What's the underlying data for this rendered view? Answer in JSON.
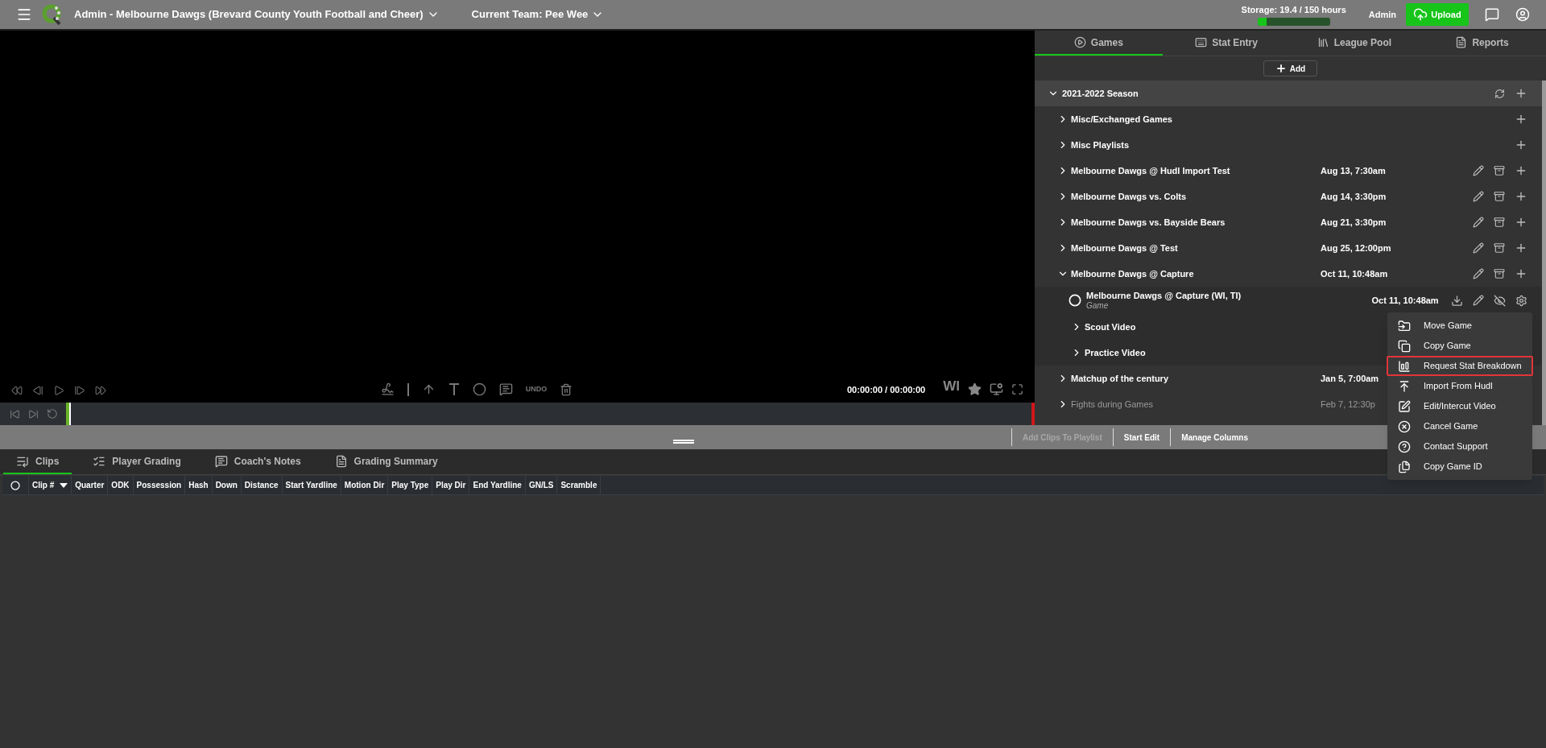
{
  "header": {
    "account": "Admin - Melbourne Dawgs (Brevard County Youth Football and Cheer)",
    "team": "Current Team: Pee Wee",
    "storage": {
      "label": "Storage: 19.4 / 150 hours",
      "level": 0.13
    },
    "user": "Admin",
    "upload": "Upload"
  },
  "player": {
    "undo": "UNDO",
    "time": "00:00:00 / 00:00:00",
    "badge": "WI"
  },
  "panel_tabs": [
    {
      "label": "Games",
      "selected": true
    },
    {
      "label": "Stat Entry",
      "selected": false
    },
    {
      "label": "League Pool",
      "selected": false
    },
    {
      "label": "Reports",
      "selected": false
    }
  ],
  "add_button": "Add",
  "season": {
    "title": "2021-2022 Season",
    "expanded": true
  },
  "games": [
    {
      "kind": "folder",
      "title": "Misc/Exchanged Games",
      "expanded": false,
      "dimmed": false
    },
    {
      "kind": "folder",
      "title": "Misc Playlists",
      "expanded": false,
      "dimmed": false
    },
    {
      "kind": "game",
      "title": "Melbourne Dawgs @ Hudl Import Test",
      "date": "Aug 13, 7:30am",
      "expanded": false,
      "dimmed": false
    },
    {
      "kind": "game",
      "title": "Melbourne Dawgs vs. Colts",
      "date": "Aug 14, 3:30pm",
      "expanded": false,
      "dimmed": false
    },
    {
      "kind": "game",
      "title": "Melbourne Dawgs vs. Bayside Bears",
      "date": "Aug 21, 3:30pm",
      "expanded": false,
      "dimmed": false
    },
    {
      "kind": "game",
      "title": "Melbourne Dawgs @ Test",
      "date": "Aug 25, 12:00pm",
      "expanded": false,
      "dimmed": false
    },
    {
      "kind": "game",
      "title": "Melbourne Dawgs @ Capture",
      "date": "Oct 11, 10:48am",
      "expanded": true,
      "dimmed": false,
      "children": [
        {
          "kind": "film",
          "title": "Melbourne Dawgs @ Capture (WI, TI)",
          "subtitle": "Game",
          "date": "Oct 11, 10:48am"
        },
        {
          "kind": "subfolder",
          "title": "Scout Video",
          "expanded": false
        },
        {
          "kind": "subfolder",
          "title": "Practice Video",
          "expanded": false
        }
      ]
    },
    {
      "kind": "game",
      "title": "Matchup of the century",
      "date": "Jan 5, 7:00am",
      "expanded": false,
      "dimmed": false
    },
    {
      "kind": "game",
      "title": "Fights during Games",
      "date": "Feb 7, 12:30p",
      "expanded": false,
      "dimmed": true
    }
  ],
  "toolbar": [
    {
      "label": "Add Clips To Playlist",
      "disabled": true
    },
    {
      "label": "Start Edit",
      "disabled": false
    },
    {
      "label": "Manage Columns",
      "disabled": false
    }
  ],
  "bottom_tabs": [
    {
      "label": "Clips",
      "selected": true
    },
    {
      "label": "Player Grading",
      "selected": false
    },
    {
      "label": "Coach's Notes",
      "selected": false
    },
    {
      "label": "Grading Summary",
      "selected": false
    }
  ],
  "columns": [
    "Clip #",
    "Quarter",
    "ODK",
    "Possession",
    "Hash",
    "Down",
    "Distance",
    "Start Yardline",
    "Motion Dir",
    "Play Type",
    "Play Dir",
    "End Yardline",
    "GN/LS",
    "Scramble"
  ],
  "menu": [
    {
      "label": "Move Game",
      "selected": false
    },
    {
      "label": "Copy Game",
      "selected": false
    },
    {
      "label": "Request Stat Breakdown",
      "selected": true
    },
    {
      "label": "Import From Hudl",
      "selected": false
    },
    {
      "label": "Edit/Intercut Video",
      "selected": false
    },
    {
      "label": "Cancel Game",
      "selected": false
    },
    {
      "label": "Contact Support",
      "selected": false
    },
    {
      "label": "Copy Game ID",
      "selected": false
    }
  ]
}
